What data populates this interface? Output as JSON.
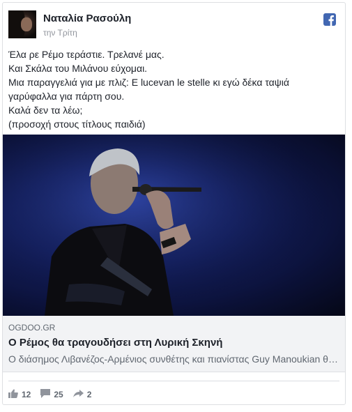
{
  "post": {
    "author": "Ναταλία Ρασούλη",
    "time": "την Τρίτη",
    "text_lines": [
      "Έλα ρε Ρέμο τεράστιε. Τρελανέ μας.",
      "Και Σκάλα του Μιλάνου εύχομαι.",
      "Μια παραγγελιά για με πλιζ: E lucevan le stelle κι εγώ δέκα ταψιά",
      "γαρύφαλλα για πάρτη σου.",
      "Καλά δεν τα λέω;",
      "(προσοχή στους τίτλους παιδιά)"
    ]
  },
  "link": {
    "domain": "OGDOO.GR",
    "title": "Ο Ρέμος θα τραγουδήσει στη Λυρική Σκηνή",
    "description": "Ο διάσημος Λιβανέζος-Αρμένιος συνθέτης και πιανίστας Guy Manoukian θα ..."
  },
  "stats": {
    "likes": "12",
    "comments": "25",
    "shares": "2"
  },
  "icons": {
    "brand": "facebook-icon",
    "like": "thumbs-up-icon",
    "comment": "comment-icon",
    "share": "share-arrow-icon"
  },
  "colors": {
    "facebook_blue": "#4267b2",
    "meta_gray": "#606770",
    "link_bg": "#f2f3f5"
  }
}
